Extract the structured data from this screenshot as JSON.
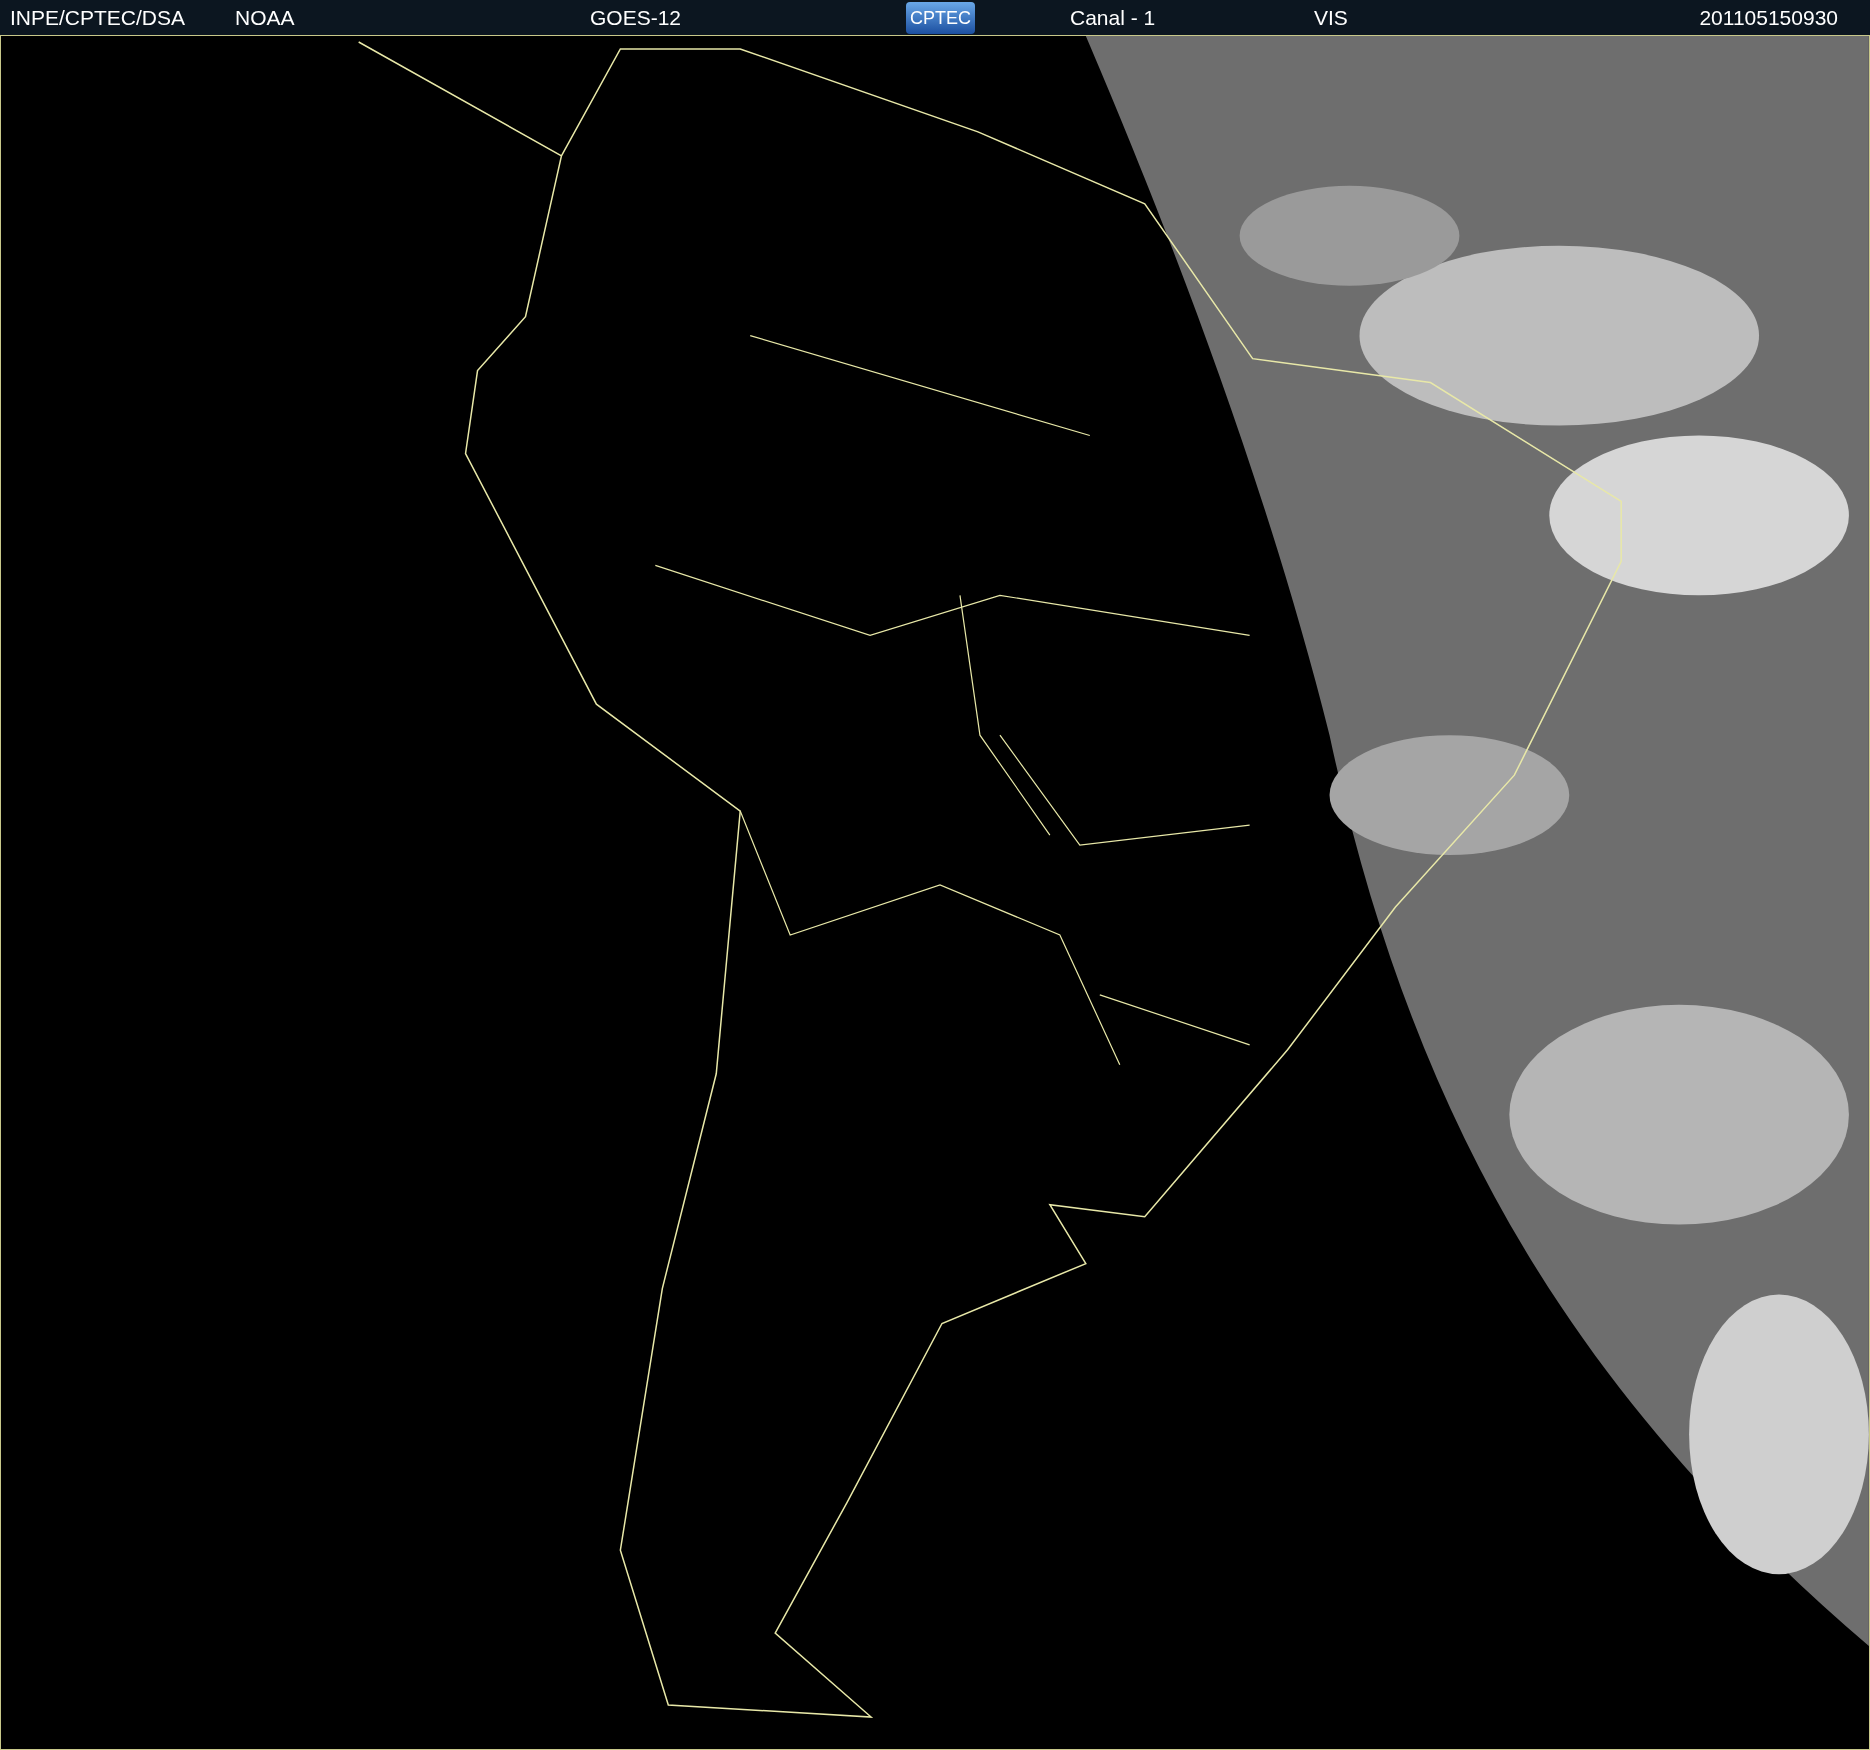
{
  "header": {
    "items": [
      {
        "kind": "text",
        "text": "INPE/CPTEC/DSA"
      },
      {
        "kind": "text",
        "text": "NOAA"
      },
      {
        "kind": "text",
        "text": "GOES-12"
      },
      {
        "kind": "logo",
        "text": "CPTEC"
      },
      {
        "kind": "text",
        "text": "Canal - 1"
      },
      {
        "kind": "text",
        "text": "VIS"
      },
      {
        "kind": "text",
        "text": "201105150930"
      }
    ]
  }
}
